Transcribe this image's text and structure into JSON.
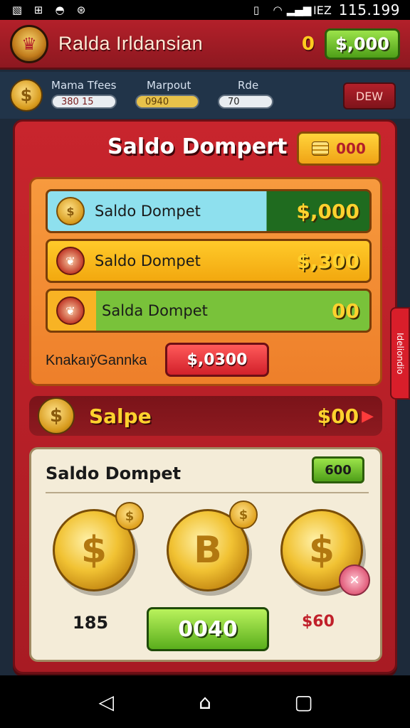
{
  "status_bar": {
    "left_icons": [
      "image-icon",
      "cast-icon",
      "sync-icon",
      "notification-icon"
    ],
    "right_icons": [
      "vibrate-icon",
      "wifi-icon",
      "signal-icon",
      "battery-icon"
    ],
    "time": "115.199",
    "battery_label": "IEZ"
  },
  "header": {
    "title": "Ralda Irldansian",
    "zero_value": "0",
    "balance_button": "$,000"
  },
  "stats": {
    "items": [
      {
        "label": "Mama Tfees",
        "value": "380 15"
      },
      {
        "label": "Marpout",
        "value": "0940"
      },
      {
        "label": "Rde",
        "value": "70"
      }
    ],
    "dew_button": "DEW"
  },
  "panel": {
    "title": "Saldo Dompert",
    "top_button_value": "000",
    "rows": [
      {
        "label": "Saldo Dompet",
        "value": "$,000"
      },
      {
        "label": "Saldo Dompet",
        "value": "$,300"
      },
      {
        "label": "Salda Dompet",
        "value": "00"
      }
    ],
    "sub_label": "Knakaıy̆Gannka",
    "sub_button": "$,0300",
    "salpe": {
      "label": "Salpe",
      "value": "$00"
    },
    "cream": {
      "title": "Saldo Dompet",
      "button": "600",
      "count_left": "185",
      "count_right": "$60",
      "main_button": "0040"
    }
  },
  "side_tab": "Ideliondio",
  "colors": {
    "brand_red": "#b3202a",
    "accent_green": "#5aae1c",
    "accent_gold": "#ffd22e",
    "panel_orange": "#ee7f2a",
    "cream": "#f4ecd8"
  }
}
